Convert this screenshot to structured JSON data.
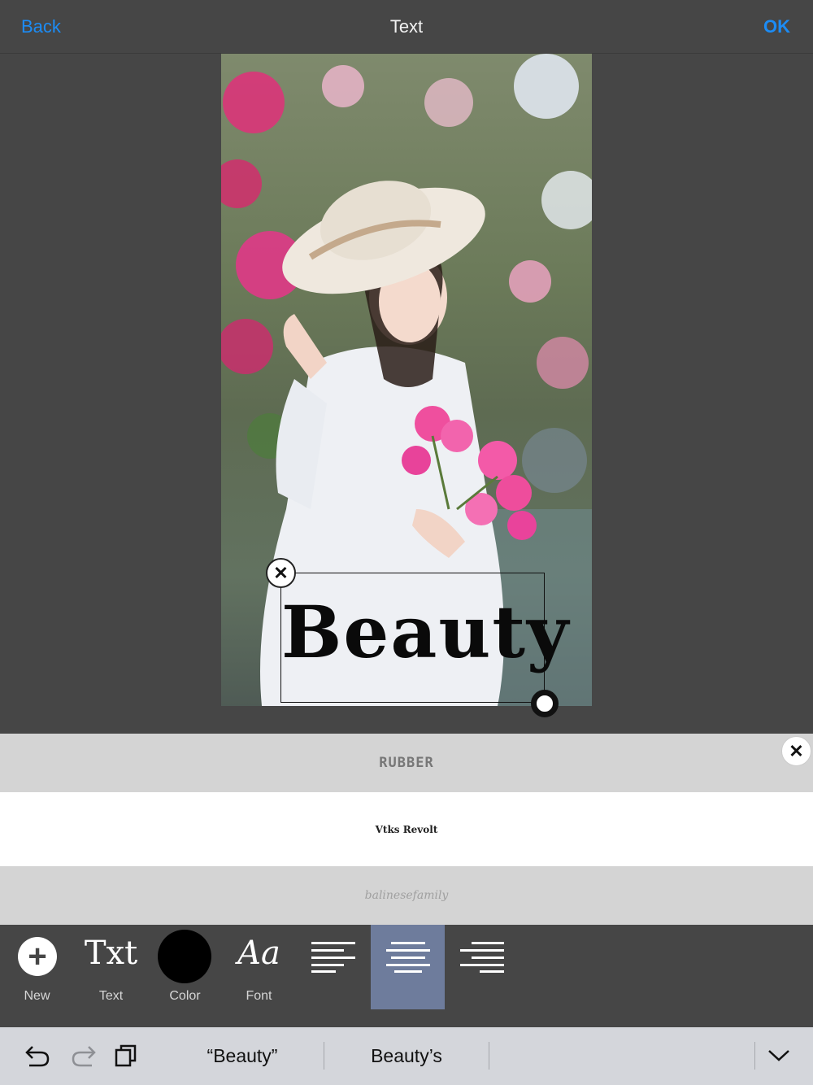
{
  "navbar": {
    "back_label": "Back",
    "title": "Text",
    "ok_label": "OK"
  },
  "colors": {
    "accent": "#1c8cf5",
    "background": "#464646",
    "active_tool": "#6e7c9c",
    "selected_text_color": "#000000"
  },
  "canvas": {
    "overlay_text": "Beauty"
  },
  "font_list": {
    "items": [
      {
        "name": "RUBBER"
      },
      {
        "name": "Vtks Revolt"
      },
      {
        "name": "balinesefamily"
      }
    ]
  },
  "toolbar": {
    "tools": [
      {
        "label": "New",
        "icon": "plus-circle-icon"
      },
      {
        "label": "Text",
        "glyph": "Txt",
        "icon": "txt-icon"
      },
      {
        "label": "Color",
        "icon": "color-swatch-icon"
      },
      {
        "label": "Font",
        "glyph": "Aa",
        "icon": "font-icon"
      }
    ],
    "alignments": [
      {
        "name": "align-left",
        "selected": false
      },
      {
        "name": "align-center",
        "selected": true
      },
      {
        "name": "align-right",
        "selected": false
      }
    ]
  },
  "suggestion_bar": {
    "suggestions": [
      "“Beauty”",
      "Beauty’s"
    ]
  }
}
